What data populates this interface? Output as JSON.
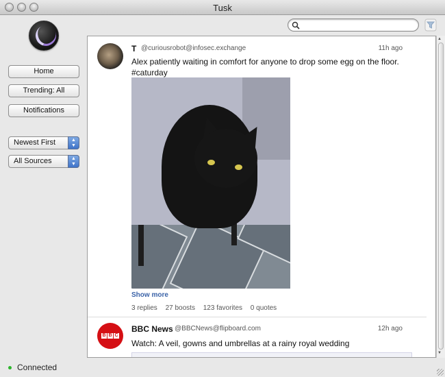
{
  "window": {
    "title": "Tusk"
  },
  "sidebar": {
    "buttons": [
      "Home",
      "Trending: All",
      "Notifications"
    ],
    "sort": "Newest First",
    "source": "All Sources"
  },
  "status": {
    "text": "Connected"
  },
  "search": {
    "value": "",
    "placeholder": ""
  },
  "posts": [
    {
      "author": "T",
      "handle": "@curiousrobot@infosec.exchange",
      "time": "11h ago",
      "text": "Alex patiently waiting in comfort for anyone to drop some egg on the floor. #caturday",
      "show_more": "Show more",
      "replies": "3 replies",
      "boosts": "27 boosts",
      "favorites": "123 favorites",
      "quotes": "0 quotes"
    },
    {
      "author": "BBC News",
      "handle": "@BBCNews@flipboard.com",
      "time": "12h ago",
      "text": "Watch: A veil, gowns and umbrellas at a rainy royal wedding",
      "avatar_text": [
        "B",
        "B",
        "C"
      ]
    }
  ],
  "colors": {
    "accent": "#3b63a8",
    "bbc_red": "#d50f14",
    "connected": "#2db52d"
  }
}
